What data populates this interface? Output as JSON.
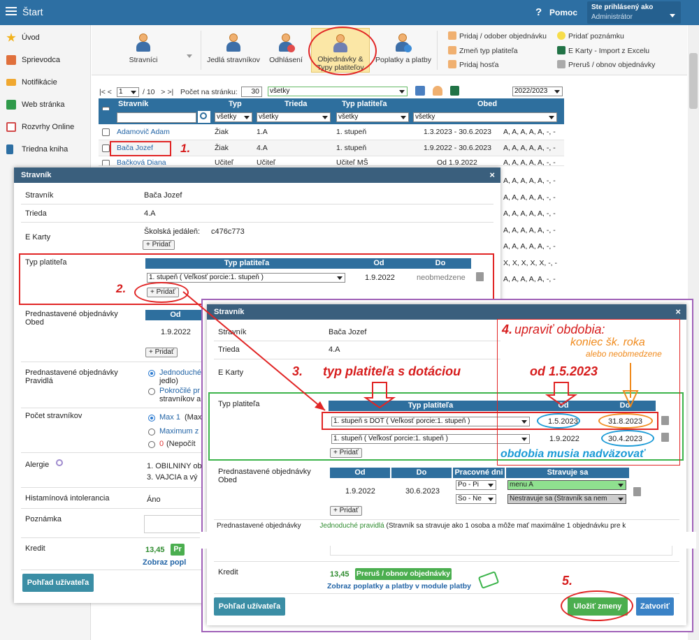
{
  "topbar": {
    "title": "Štart",
    "help": "Pomoc",
    "user_line1": "Ste prihlásený ako",
    "user_line2": "Administrátor"
  },
  "sidebar": {
    "items": [
      {
        "label": "Úvod",
        "color": "#f2b21b"
      },
      {
        "label": "Sprievodca",
        "color": "#e0703c"
      },
      {
        "label": "Notifikácie",
        "color": "#f0a830"
      },
      {
        "label": "Web stránka",
        "color": "#2f9a4a"
      },
      {
        "label": "Rozvrhy Online",
        "color": "#d24a4a"
      },
      {
        "label": "Triedna kniha",
        "color": "#2d6fa3"
      }
    ]
  },
  "ribbon": {
    "buttons": [
      "Stravníci",
      "Jedlá stravníkov",
      "Odhlásení",
      "Objednávky & Typy platiteľov",
      "Poplatky a platby"
    ],
    "links_col1": [
      "Pridaj / odober objednávku",
      "Zmeň typ platiteľa",
      "Pridaj hosťa"
    ],
    "links_col2": [
      "Pridať poznámku",
      "E Karty - Import z Excelu",
      "Preruš / obnov objednávky"
    ]
  },
  "pager": {
    "first": "|<",
    "prev": "<",
    "page": "1",
    "of": "/ 10",
    "next": ">",
    "last": ">|",
    "per_page_label": "Počet na stránku:",
    "per_page": "30",
    "filter": "všetky",
    "year": "2022/2023"
  },
  "grid": {
    "headers": [
      "Stravník",
      "Typ",
      "Trieda",
      "Typ platiteľa",
      "Obed"
    ],
    "filters": [
      "všetky",
      "všetky",
      "všetky",
      "všetky"
    ],
    "rows": [
      {
        "name": "Adamovič Adam",
        "typ": "Žiak",
        "trieda": "1.A",
        "platitel": "1. stupeň",
        "obdobie": "1.3.2023 - 30.6.2023",
        "obed": "A, A, A, A, A, -, -"
      },
      {
        "name": "Bača Jozef",
        "typ": "Žiak",
        "trieda": "4.A",
        "platitel": "1. stupeň",
        "obdobie": "1.9.2022 - 30.6.2023",
        "obed": "A, A, A, A, A, -, -"
      },
      {
        "name": "Bačková Diana",
        "typ": "Učiteľ",
        "trieda": "Učiteľ",
        "platitel": "Učiteľ MŠ",
        "obdobie": "Od 1.9.2022",
        "obed": "A, A, A, A, A, -, -"
      }
    ],
    "right_col": [
      "A, A, A, A, A, -, -",
      "A, A, A, A, A, -, -",
      "A, A, A, A, A, -, -",
      "A, A, A, A, A, -, -",
      "A, A, A, A, A, -, -",
      "X, X, X, X, X, -, -",
      "A, A, A, A, A, -, -"
    ]
  },
  "dlg1": {
    "title": "Stravník",
    "close": "×",
    "stravnik_label": "Stravník",
    "stravnik": "Bača Jozef",
    "trieda_label": "Trieda",
    "trieda": "4.A",
    "ekarty_label": "E Karty",
    "ekarty_school": "Školská jedáleň:",
    "ekarty_code": "c476c773",
    "add": "+ Pridať",
    "typ_label": "Typ platiteľa",
    "typ_headers": [
      "Typ platiteľa",
      "Od",
      "Do"
    ],
    "typ_row": {
      "typ": "1. stupeň ( Veľkosť porcie:1. stupeň )",
      "od": "1.9.2022",
      "do": "neobmedzene"
    },
    "pred_label": "Prednastavené objednávky Obed",
    "pred_head": "Od",
    "pred_od": "1.9.2022",
    "pravidla_label": "Prednastavené objednávky Pravidlá",
    "pravidla_opt1": "Jednoduché",
    "pravidla_opt1b": "jedlo)",
    "pravidla_opt2": "Pokročilé pr",
    "pravidla_opt2b": "stravníkov a",
    "pocet_label": "Počet stravníkov",
    "pocet_opt1": "Max 1",
    "pocet_opt1b": "(Max",
    "pocet_opt2": "Maximum z",
    "pocet_opt3": "0",
    "pocet_opt3b": "(Nepočít",
    "alergie_label": "Alergie",
    "alergie1": "1. OBILNINY ob",
    "alergie2": "3. VAJCIA a vý",
    "hist_label": "Histamínová intolerancia",
    "hist": "Áno",
    "pozn_label": "Poznámka",
    "kredit_label": "Kredit",
    "kredit": "13,45",
    "kredit_btn": "Pr",
    "zobraz": "Zobraz popl",
    "user_btn": "Pohľad užívateľa"
  },
  "dlg2": {
    "title": "Stravník",
    "close": "×",
    "stravnik_label": "Stravník",
    "stravnik": "Bača Jozef",
    "trieda_label": "Trieda",
    "trieda": "4.A",
    "ekarty_label": "E Karty",
    "typ_label": "Typ platiteľa",
    "typ_headers": [
      "Typ platiteľa",
      "Od",
      "Do"
    ],
    "rows": [
      {
        "typ": "1. stupeň s DOT ( Veľkosť porcie:1. stupeň )",
        "od": "1.5.2023",
        "do": "31.8.2023"
      },
      {
        "typ": "1. stupeň ( Veľkosť porcie:1. stupeň )",
        "od": "1.9.2022",
        "do": "30.4.2023"
      }
    ],
    "add": "+ Pridať",
    "pred_label": "Prednastavené objednávky Obed",
    "pred_headers": [
      "Od",
      "Do",
      "Pracovné dni",
      "Stravuje sa"
    ],
    "pred_row": {
      "od": "1.9.2022",
      "do": "30.6.2023",
      "dni1": "Po - Pi",
      "dni2": "So - Ne",
      "strav1": "menu A",
      "strav2": "Nestravuje sa (Stravník sa nem"
    },
    "pravidla_label": "Prednastavené objednávky",
    "pravidla_text": "Jednoduché pravidlá",
    "pravidla_rest": "(Stravník sa stravuje ako 1 osoba a môže mať maximálne 1 objednávku pre k",
    "kredit_label": "Kredit",
    "kredit": "13,45",
    "kredit_btn": "Preruš / obnov objednávky",
    "zobraz": "Zobraz poplatky a platby v module platby",
    "user_btn": "Pohľad užívateľa",
    "save": "Uložiť zmeny",
    "close_btn": "Zatvoriť"
  },
  "annotations": {
    "a1": "1.",
    "a2": "2.",
    "a3": "3.",
    "a3text": "typ platiteľa s dotáciou",
    "a4": "4.",
    "a4text": "upraviť obdobia:",
    "a4b": "koniec šk. roka",
    "a4c": "alebo neobmedzene",
    "a_od": "od 1.5.2023",
    "a_nadv": "obdobia musia nadväzovať",
    "a5": "5."
  },
  "colors": {
    "topbar": "#2d6fa3",
    "header": "#2e6f9e",
    "annotation_red": "#d61c1c",
    "annotation_orange": "#f08a1c",
    "annotation_blue": "#1a9ad6",
    "dialog_purple": "#a061b8",
    "green_frame": "#3cb44b"
  }
}
